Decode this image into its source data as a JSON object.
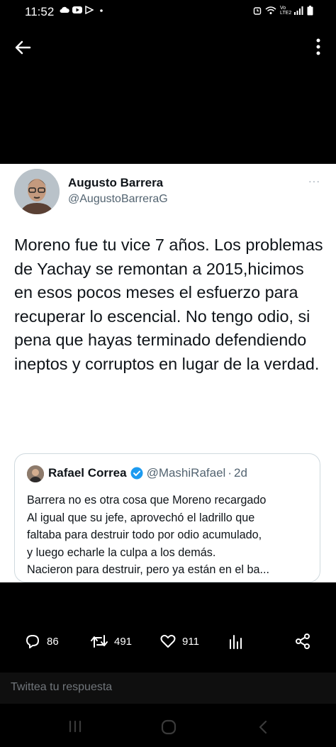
{
  "status_bar": {
    "time": "11:52",
    "network_label": "Vo LTE2",
    "icons": [
      "cloud-icon",
      "youtube-icon",
      "play-store-icon",
      "dot-icon",
      "alarm-icon",
      "wifi-icon",
      "signal-icon",
      "battery-icon"
    ]
  },
  "tweet": {
    "author_name": "Augusto Barrera",
    "author_handle": "@AugustoBarreraG",
    "more_label": "···",
    "text": "Moreno fue tu vice 7 años. Los problemas de Yachay se remontan a 2015,hicimos en esos pocos meses el esfuerzo para recuperar lo escencial. No tengo odio, si pena que hayas terminado defendiendo ineptos y corruptos en lugar de la verdad.",
    "quote": {
      "name": "Rafael Correa",
      "handle": "@MashiRafael",
      "separator": "·",
      "time": "2d",
      "lines": [
        "Barrera no es otra cosa que Moreno recargado",
        "Al igual que su jefe, aprovechó el ladrillo que",
        "faltaba para destruir todo por odio acumulado,",
        "y luego echarle la culpa a los demás.",
        "Nacieron para destruir, pero ya están en el ba..."
      ]
    }
  },
  "actions": {
    "replies": "86",
    "retweets": "491",
    "likes": "911"
  },
  "reply_box": {
    "placeholder": "Twittea tu respuesta"
  },
  "colors": {
    "accent": "#1d9bf0",
    "background": "#000000",
    "card": "#ffffff",
    "muted": "#536471"
  }
}
